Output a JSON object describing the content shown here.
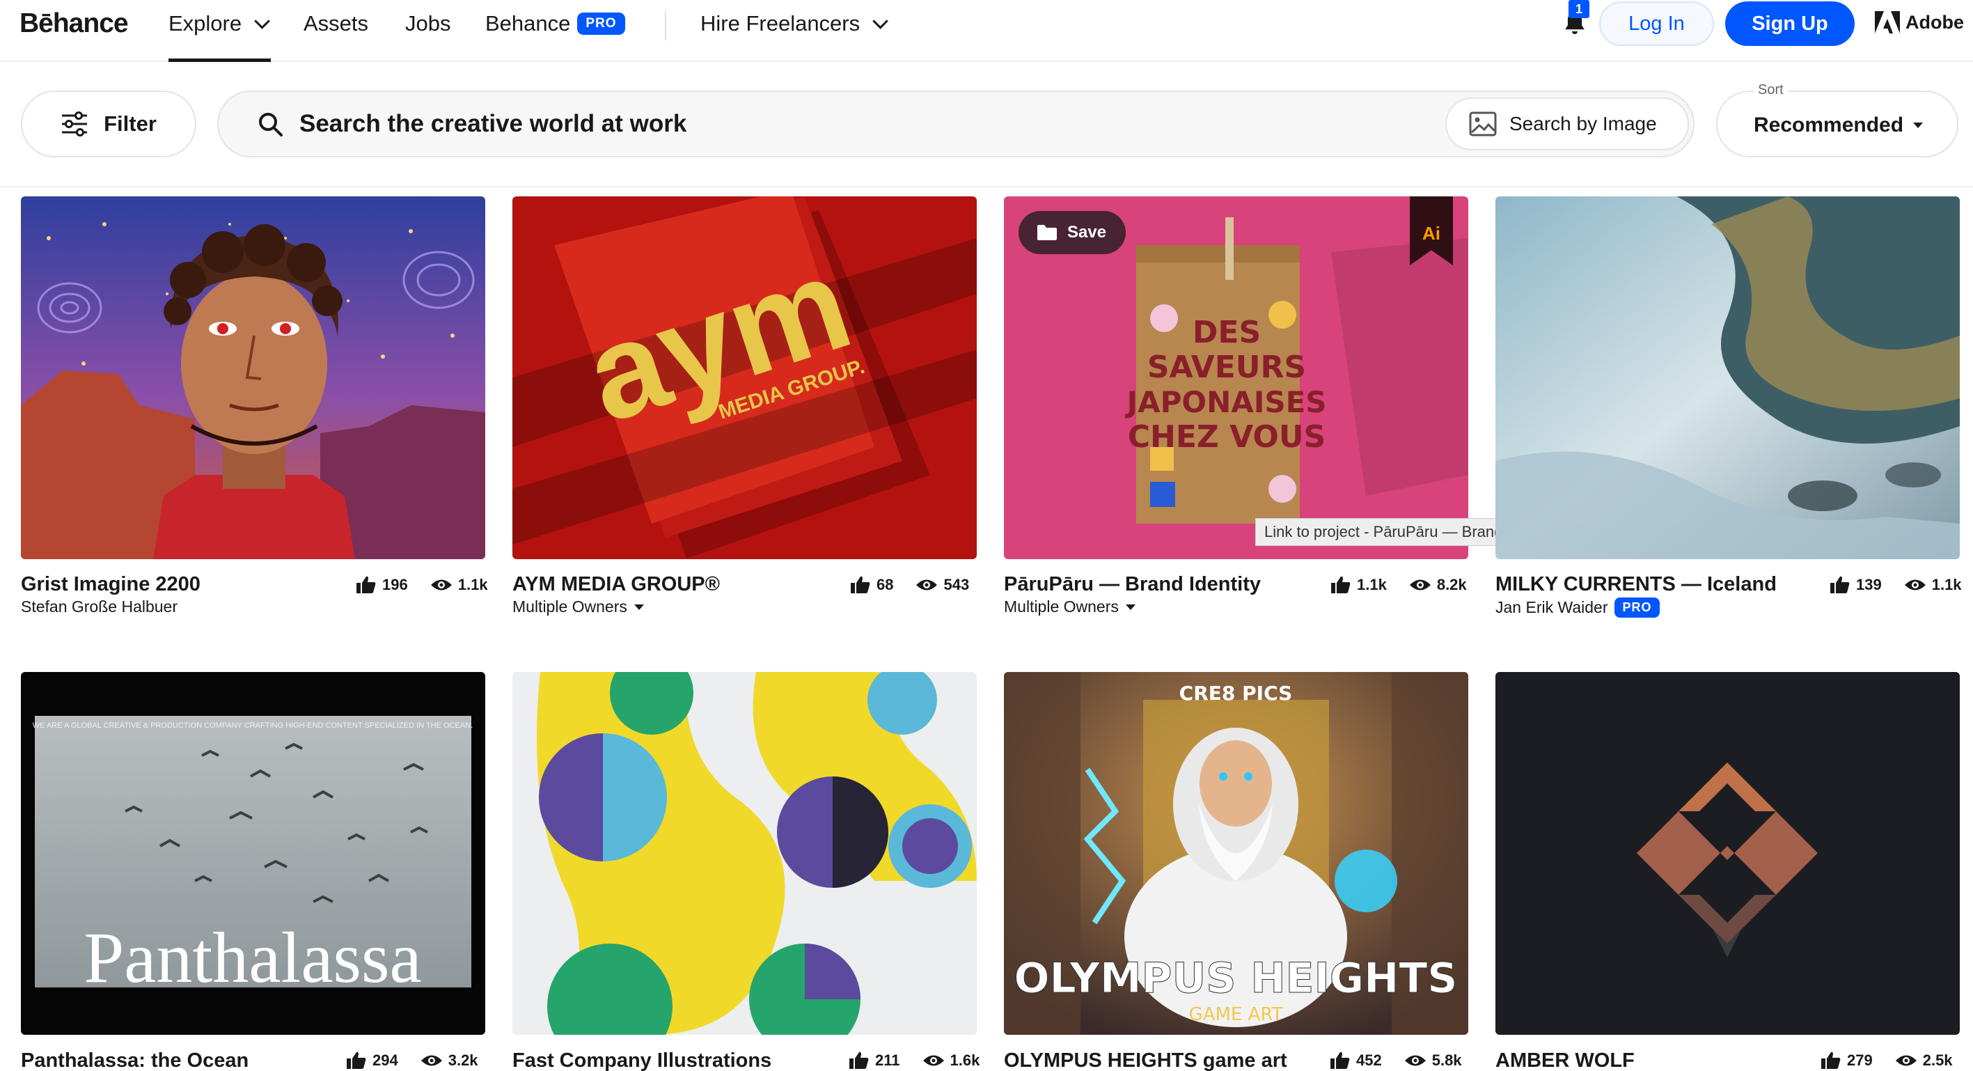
{
  "nav": {
    "logo": "Bēhance",
    "explore": "Explore",
    "assets": "Assets",
    "jobs": "Jobs",
    "behance": "Behance",
    "pro": "PRO",
    "hire": "Hire Freelancers",
    "notifications_count": "1",
    "login": "Log In",
    "signup": "Sign Up",
    "adobe": "Adobe"
  },
  "toolbar": {
    "filter": "Filter",
    "search_query": "Search the creative world at work",
    "search_by_image": "Search by Image",
    "sort_label": "Sort",
    "sort_value": "Recommended"
  },
  "colors": {
    "accent": "#0057ff"
  },
  "projects": [
    {
      "title": "Grist Imagine 2200",
      "owner": "Stefan Große Halbuer",
      "likes": "196",
      "views": "1.1k"
    },
    {
      "title": "AYM MEDIA GROUP®",
      "owner": "Multiple Owners",
      "likes": "68",
      "views": "543"
    },
    {
      "title": "PāruPāru — Brand Identity",
      "owner": "Multiple Owners",
      "likes": "1.1k",
      "views": "8.2k",
      "save": "Save",
      "ai_badge": "Ai",
      "tooltip": "Link to project - PāruPāru — Brand Identity"
    },
    {
      "title": "MILKY CURRENTS — Iceland",
      "owner": "Jan Erik Waider",
      "owner_badge": "PRO",
      "likes": "139",
      "views": "1.1k"
    },
    {
      "title": "Panthalassa: the Ocean",
      "likes": "294",
      "views": "3.2k"
    },
    {
      "title": "Fast Company Illustrations",
      "likes": "211",
      "views": "1.6k"
    },
    {
      "title": "OLYMPUS HEIGHTS game art",
      "likes": "452",
      "views": "5.8k"
    },
    {
      "title": "AMBER WOLF",
      "likes": "279",
      "views": "2.5k"
    }
  ],
  "artwork": {
    "aym_logo": "aym",
    "aym_sub": "MEDIA GROUP.",
    "paru_bag": "DES SAVEURS JAPONAISES CHEZ VOUS",
    "panthalassa_word": "Panthalassa",
    "panthalassa_caption": "WE ARE A GLOBAL CREATIVE & PRODUCTION COMPANY CRAFTING HIGH-END CONTENT SPECIALIZED IN THE OCEAN.",
    "olympus_studio": "CRE8 PICS",
    "olympus_title": "OLYMPUS HEIGHTS",
    "olympus_sub": "GAME ART"
  }
}
